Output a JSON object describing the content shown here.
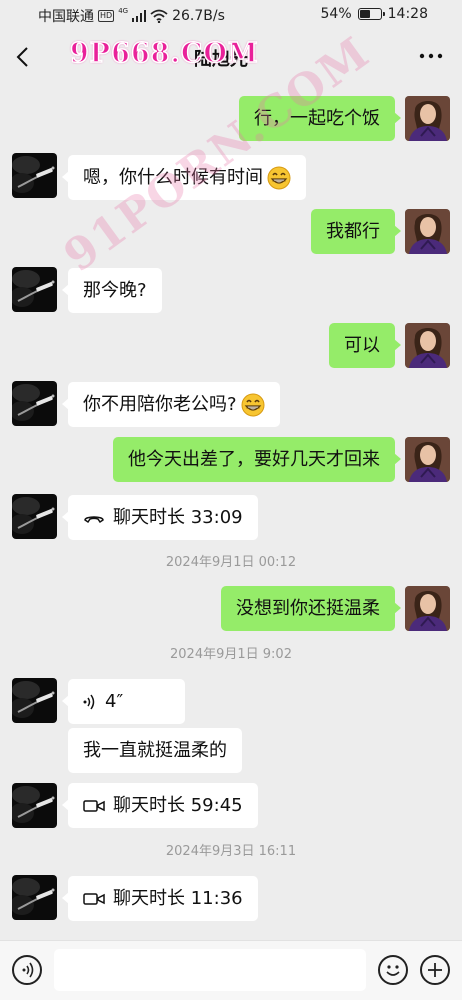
{
  "status_bar": {
    "carrier": "中国联通",
    "hd_badge": "HD",
    "network_badge": "4G",
    "speed": "26.7B/s",
    "battery_percent": "54%",
    "battery_level": 0.54,
    "time": "14:28"
  },
  "header": {
    "contact_name": "陆旭光",
    "back_icon": "chevron-left-icon",
    "more_icon": "more-dots-icon"
  },
  "watermarks": {
    "top": "9P668.COM",
    "diagonal": "91PORN.COM"
  },
  "messages": [
    {
      "from": "me",
      "text": "行，一起吃个饭"
    },
    {
      "from": "peer",
      "text": "嗯，你什么时候有时间",
      "emoji": "grinning-face-icon"
    },
    {
      "from": "me",
      "text": "我都行"
    },
    {
      "from": "peer",
      "text": "那今晚?"
    },
    {
      "from": "me",
      "text": "可以"
    },
    {
      "from": "peer",
      "text": "你不用陪你老公吗?",
      "emoji": "grinning-face-icon"
    },
    {
      "from": "me",
      "text": "他今天出差了，要好几天才回来"
    },
    {
      "from": "peer",
      "type": "voice-call",
      "text": "聊天时长 33:09",
      "icon": "phone-hangup-icon"
    },
    {
      "from": "me",
      "text": "没想到你还挺温柔"
    },
    {
      "from": "peer",
      "type": "voice-message",
      "text": "4″",
      "icon": "voice-wave-icon"
    },
    {
      "from": "peer",
      "text": "我一直就挺温柔的"
    },
    {
      "from": "peer",
      "type": "video-call",
      "text": "聊天时长 59:45",
      "icon": "video-camera-icon"
    },
    {
      "from": "peer",
      "type": "video-call",
      "text": "聊天时长 11:36",
      "icon": "video-camera-icon"
    }
  ],
  "timestamps": [
    "2024年9月1日 00:12",
    "2024年9月1日 9:02",
    "2024年9月3日 16:11"
  ],
  "input_bar": {
    "voice_icon": "voice-input-icon",
    "emoji_icon": "emoji-icon",
    "add_icon": "plus-icon",
    "placeholder": ""
  },
  "colors": {
    "background": "#ededed",
    "my_bubble": "#95ec69",
    "peer_bubble": "#ffffff",
    "timestamp_text": "#9a9a9a",
    "watermark": "#e9219a"
  }
}
